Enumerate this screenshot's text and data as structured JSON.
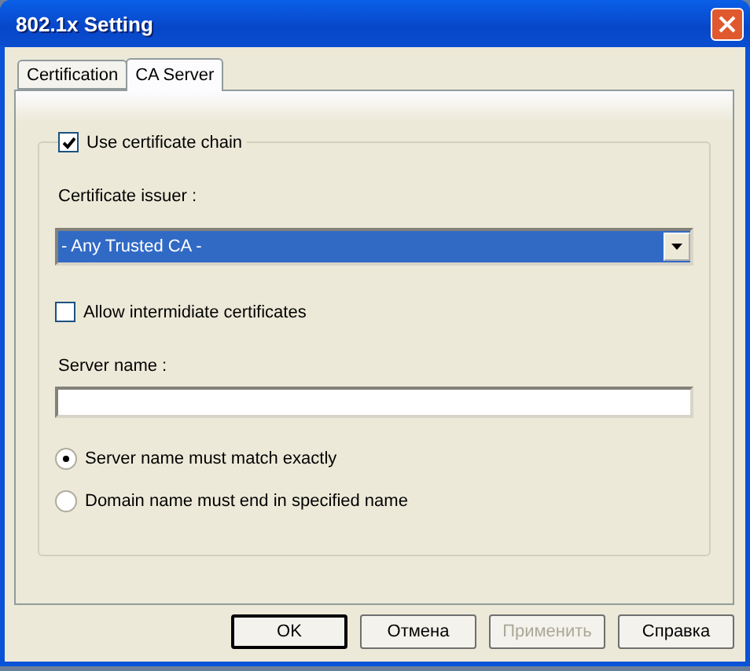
{
  "window": {
    "title": "802.1x Setting"
  },
  "tabs": [
    {
      "label": "Certification",
      "selected": false
    },
    {
      "label": "CA Server",
      "selected": true
    }
  ],
  "use_chain": {
    "label": "Use certificate chain",
    "checked": true
  },
  "issuer": {
    "label": "Certificate issuer :",
    "value": "- Any Trusted CA -"
  },
  "allow_intermediate": {
    "label": "Allow intermidiate certificates",
    "checked": false
  },
  "server_name": {
    "label": "Server name :"
  },
  "match_options": [
    {
      "label": "Server name must match exactly",
      "selected": true
    },
    {
      "label": "Domain name must end in specified name",
      "selected": false
    }
  ],
  "buttons": [
    {
      "label": "OK",
      "default": true,
      "disabled": false
    },
    {
      "label": "Отмена",
      "default": false,
      "disabled": false
    },
    {
      "label": "Применить",
      "default": false,
      "disabled": true
    },
    {
      "label": "Справка",
      "default": false,
      "disabled": false
    }
  ]
}
